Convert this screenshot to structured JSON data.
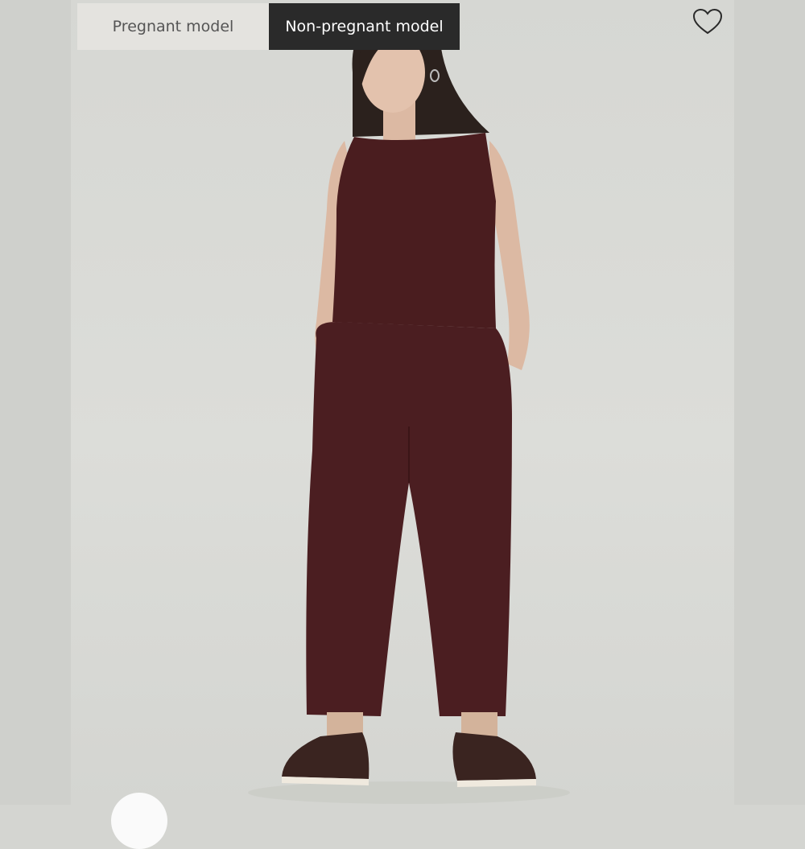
{
  "model_toggle": {
    "options": [
      "Pregnant model",
      "Non-pregnant model"
    ],
    "selected": "Non-pregnant model"
  },
  "favorite": {
    "icon": "heart-outline-icon"
  },
  "colors": {
    "garment": "#4a1d1f",
    "backdrop": "#d6d7d3",
    "toggle_active": "#2a2a2a",
    "toggle_inactive": "#e4e3df"
  }
}
